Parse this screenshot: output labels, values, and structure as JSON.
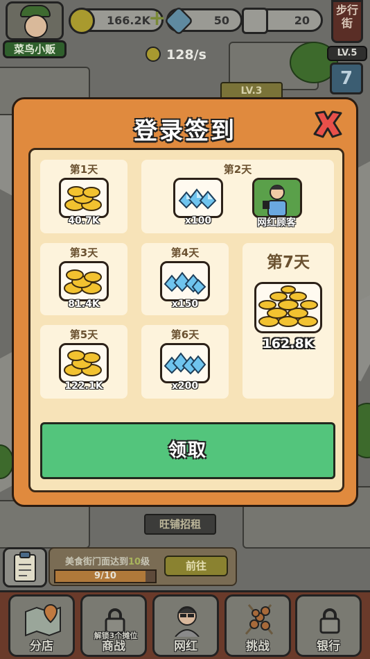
{
  "hud": {
    "player_name": "菜鸟小贩",
    "coins": "166.2K",
    "gems": "50",
    "likes": "20",
    "income_rate": "128/s",
    "street_label": "步行街",
    "level": "LV.5",
    "calendar_day": "7",
    "building_level": "LV.3"
  },
  "signin": {
    "title": "登录签到",
    "days": [
      {
        "label": "第1天",
        "rewards": [
          {
            "icon": "coin-stack-icon",
            "qty": "40.7K"
          }
        ]
      },
      {
        "label": "第2天",
        "rewards": [
          {
            "icon": "gem-pile-icon",
            "qty": "x100"
          },
          {
            "icon": "influencer-customer-icon",
            "qty": "网红顾客"
          }
        ]
      },
      {
        "label": "第3天",
        "rewards": [
          {
            "icon": "coin-stack-icon",
            "qty": "81.4K"
          }
        ]
      },
      {
        "label": "第4天",
        "rewards": [
          {
            "icon": "gem-pile-icon",
            "qty": "x150"
          }
        ]
      },
      {
        "label": "第5天",
        "rewards": [
          {
            "icon": "coin-stack-icon",
            "qty": "122.1K"
          }
        ]
      },
      {
        "label": "第6天",
        "rewards": [
          {
            "icon": "gem-pile-icon",
            "qty": "x200"
          }
        ]
      },
      {
        "label": "第7天",
        "rewards": [
          {
            "icon": "big-coin-pile-icon",
            "qty": "162.8K"
          }
        ]
      }
    ],
    "claim_label": "领取"
  },
  "task": {
    "text_before": "美食街门面达到",
    "text_highlight": "10",
    "text_after": "级",
    "progress_text": "9/10",
    "progress": 0.9,
    "go_label": "前往"
  },
  "shop_sign": "旺铺招租",
  "nav": {
    "items": [
      {
        "label": "分店",
        "icon": "map-pin-icon",
        "locked": false
      },
      {
        "label": "商战",
        "icon": "lock-icon",
        "locked": true,
        "hint": "解锁3个摊位"
      },
      {
        "label": "网红",
        "icon": "influencer-icon",
        "locked": false
      },
      {
        "label": "挑战",
        "icon": "skewer-icon",
        "locked": false
      },
      {
        "label": "银行",
        "icon": "lock-icon",
        "locked": true
      }
    ]
  },
  "colors": {
    "modal_bg": "#e08a3e",
    "panel_bg": "#f7e3b8",
    "claim_green": "#53c57c",
    "close_red": "#e8504a"
  }
}
